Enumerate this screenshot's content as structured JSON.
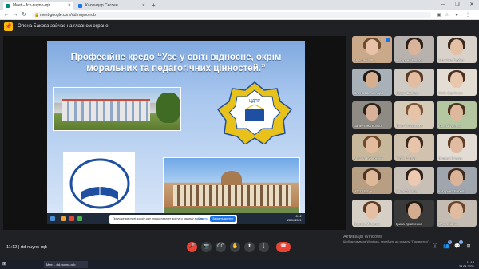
{
  "browser": {
    "tabs": [
      {
        "label": "Meet – fcx-nuyno-rqb",
        "active": true,
        "favicon_color": "#00897b"
      },
      {
        "label": "Календар Сеглен",
        "active": false,
        "favicon_color": "#1a73e8"
      }
    ],
    "url": "meet.google.com/rtd-nuyno-rqb",
    "new_tab_icon": "plus-icon"
  },
  "notice": {
    "text": "Олена Бакова зайчас на главном экране"
  },
  "slide": {
    "title": "Професійне кредо “Усе у світі відносне, окрім моральних та педагогічних цінностей.”",
    "emblem_text": "ЦДПУ",
    "share_message": "Приложение meet.google.com предоставляет доступ к вашему экрану.",
    "share_stop": "Закрыть доступ",
    "share_hide": "Скрыть",
    "time": "13:12",
    "date": "28.04.2021"
  },
  "participants": [
    {
      "name": "Анастасія Ф...",
      "skin": "#e8c2a8",
      "hair": "#6b4a2e",
      "bg": "#c9a98a",
      "speaking": true
    },
    {
      "name": "Катерина Бакова",
      "skin": "#d9b49a",
      "hair": "#2b1f18",
      "bg": "#b8b2ae",
      "speaking": false
    },
    {
      "name": "Антоніна Горбат",
      "skin": "#e3bfa4",
      "hair": "#3b2a20",
      "bg": "#d8d2ca",
      "speaking": false
    },
    {
      "name": "Олена Шапоклярн",
      "skin": "#d6ae90",
      "hair": "#1f1a16",
      "bg": "#a8b0b8",
      "speaking": false
    },
    {
      "name": "Надія Шавова",
      "skin": "#e2bda2",
      "hair": "#5a3a24",
      "bg": "#cfcac4",
      "speaking": false
    },
    {
      "name": "Юлія Сергієнко",
      "skin": "#e9c7ad",
      "hair": "#4a2f1f",
      "bg": "#e4ddd3",
      "speaking": false
    },
    {
      "name": "Валентина Кольо",
      "skin": "#d8b198",
      "hair": "#2a211b",
      "bg": "#8e8a84",
      "speaking": false
    },
    {
      "name": "Лілія Осташенко",
      "skin": "#e6c3a6",
      "hair": "#7a5234",
      "bg": "#d6cbb8",
      "speaking": false
    },
    {
      "name": "Ірина Руденко",
      "skin": "#ddb89a",
      "hair": "#4d3322",
      "bg": "#b4c7a0",
      "speaking": false
    },
    {
      "name": "Альона Кучеренко",
      "skin": "#e3bc9e",
      "hair": "#6e4a2c",
      "bg": "#c7b89c",
      "speaking": false
    },
    {
      "name": "Юлія Ковтун",
      "skin": "#e7c4aa",
      "hair": "#3a2a1e",
      "bg": "#d1c2b0",
      "speaking": false
    },
    {
      "name": "Дарина Бовкун",
      "skin": "#e0bba0",
      "hair": "#5e3d26",
      "bg": "#e3dcd4",
      "speaking": false
    },
    {
      "name": "Настя Бігун",
      "skin": "#dfb898",
      "hair": "#4a3324",
      "bg": "#b89f84",
      "speaking": false
    },
    {
      "name": "Анна Хороша",
      "skin": "#ecc9b0",
      "hair": "#2d211a",
      "bg": "#c8c0b6",
      "speaking": false
    },
    {
      "name": "Катерина Бобова",
      "skin": "#dbb497",
      "hair": "#3e2a1d",
      "bg": "#9fa6ad",
      "speaking": false
    },
    {
      "name": "Карина Мельник",
      "skin": "#e4bfa3",
      "hair": "#5c3b25",
      "bg": "#d5cfc6",
      "speaking": false
    },
    {
      "name": "Ірина Кравченко",
      "skin": "#d3ab8e",
      "hair": "#1d1813",
      "bg": "#3a3a3a",
      "speaking": false
    },
    {
      "name": "Ольга Бойко",
      "skin": "#e1bb9f",
      "hair": "#6a4429",
      "bg": "#c4bcb2",
      "speaking": false
    }
  ],
  "meet": {
    "time": "11:12",
    "separator": "|",
    "code": "rtd-nuyno-rqb",
    "controls": {
      "mic": "mic-off-icon",
      "camera": "camera-icon",
      "captions": "captions-icon",
      "hand": "raise-hand-icon",
      "present": "present-icon",
      "more": "more-icon",
      "end": "end-call-icon"
    },
    "participant_count": "8",
    "chat_badge": "1"
  },
  "activation": {
    "title": "Активація Windows",
    "subtitle": "Щоб активувати Windows, перейдіть до розділу \"Параметри\"."
  },
  "taskbar": {
    "item": "Meet - rtd-nuyno-rqb",
    "time": "11:12",
    "date": "28.04.2021"
  }
}
